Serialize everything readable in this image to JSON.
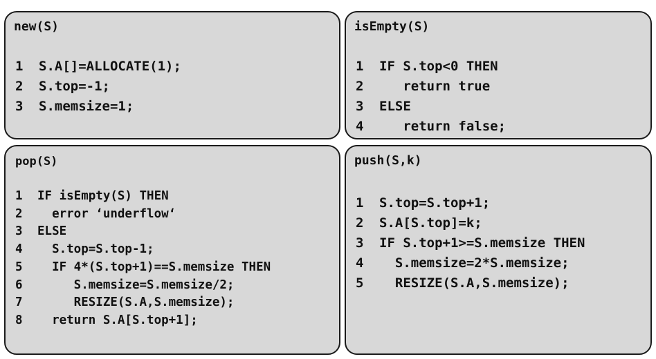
{
  "panels": {
    "new": {
      "title": "new(S)",
      "lines": [
        {
          "n": "1",
          "code": "S.A[]=ALLOCATE(1);"
        },
        {
          "n": "2",
          "code": "S.top=-1;"
        },
        {
          "n": "3",
          "code": "S.memsize=1;"
        }
      ]
    },
    "isempty": {
      "title": "isEmpty(S)",
      "lines": [
        {
          "n": "1",
          "code": "IF S.top<0 THEN"
        },
        {
          "n": "2",
          "code": "   return true"
        },
        {
          "n": "3",
          "code": "ELSE"
        },
        {
          "n": "4",
          "code": "   return false;"
        }
      ]
    },
    "pop": {
      "title": "pop(S)",
      "lines": [
        {
          "n": "1",
          "code": "IF isEmpty(S) THEN"
        },
        {
          "n": "2",
          "code": "  error ‘underflow‘"
        },
        {
          "n": "3",
          "code": "ELSE"
        },
        {
          "n": "4",
          "code": "  S.top=S.top-1;"
        },
        {
          "n": "5",
          "code": "  IF 4*(S.top+1)==S.memsize THEN"
        },
        {
          "n": "6",
          "code": "     S.memsize=S.memsize/2;"
        },
        {
          "n": "7",
          "code": "     RESIZE(S.A,S.memsize);"
        },
        {
          "n": "8",
          "code": "  return S.A[S.top+1];"
        }
      ]
    },
    "push": {
      "title": "push(S,k)",
      "lines": [
        {
          "n": "1",
          "code": "S.top=S.top+1;"
        },
        {
          "n": "2",
          "code": "S.A[S.top]=k;"
        },
        {
          "n": "3",
          "code": "IF S.top+1>=S.memsize THEN"
        },
        {
          "n": "4",
          "code": "  S.memsize=2*S.memsize;"
        },
        {
          "n": "5",
          "code": "  RESIZE(S.A,S.memsize);"
        }
      ]
    }
  }
}
